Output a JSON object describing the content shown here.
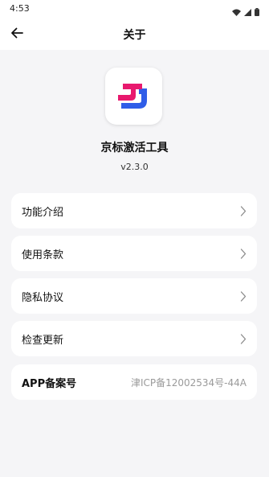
{
  "status_bar": {
    "time": "4:53"
  },
  "header": {
    "title": "关于"
  },
  "app": {
    "name": "京标激活工具",
    "version": "v2.3.0",
    "logo_colors": {
      "pink": "#e8196e",
      "blue": "#2f5de8"
    }
  },
  "menu": {
    "items": [
      {
        "label": "功能介绍"
      },
      {
        "label": "使用条款"
      },
      {
        "label": "隐私协议"
      },
      {
        "label": "检查更新"
      }
    ]
  },
  "icp": {
    "label": "APP备案号",
    "value": "津ICP备12002534号-44A"
  }
}
